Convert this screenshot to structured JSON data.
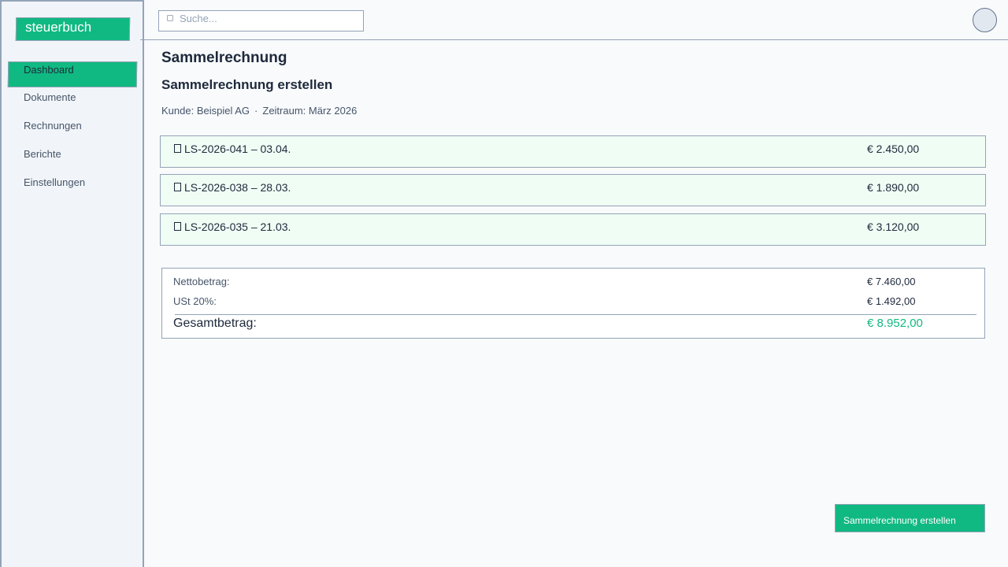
{
  "app": {
    "logo": "steuerbuch"
  },
  "sidebar": {
    "items": [
      {
        "label": "Dashboard",
        "active": true
      },
      {
        "label": "Dokumente"
      },
      {
        "label": "Rechnungen"
      },
      {
        "label": "Berichte"
      },
      {
        "label": "Einstellungen"
      }
    ]
  },
  "header": {
    "search_placeholder": "Suche..."
  },
  "main": {
    "page_title": "Sammelrechnung",
    "section_title": "Sammelrechnung erstellen",
    "customer": "Kunde: Beispiel AG",
    "separator": "·",
    "period": "Zeitraum: März 2026",
    "items": [
      {
        "label": "LS-2026-041 – 03.04.",
        "amount": "€ 2.450,00"
      },
      {
        "label": "LS-2026-038 – 28.03.",
        "amount": "€ 1.890,00"
      },
      {
        "label": "LS-2026-035 – 21.03.",
        "amount": "€ 3.120,00"
      }
    ],
    "summary": {
      "net_label": "Nettobetrag:",
      "net_value": "€ 7.460,00",
      "vat_label": "USt 20%:",
      "vat_value": "€ 1.492,00",
      "total_label": "Gesamtbetrag:",
      "total_value": "€ 8.952,00"
    },
    "submit_label": "Sammelrechnung erstellen"
  },
  "colors": {
    "accent": "#10b981",
    "border": "#94a3b8",
    "row_bg": "#f0fdf4"
  }
}
